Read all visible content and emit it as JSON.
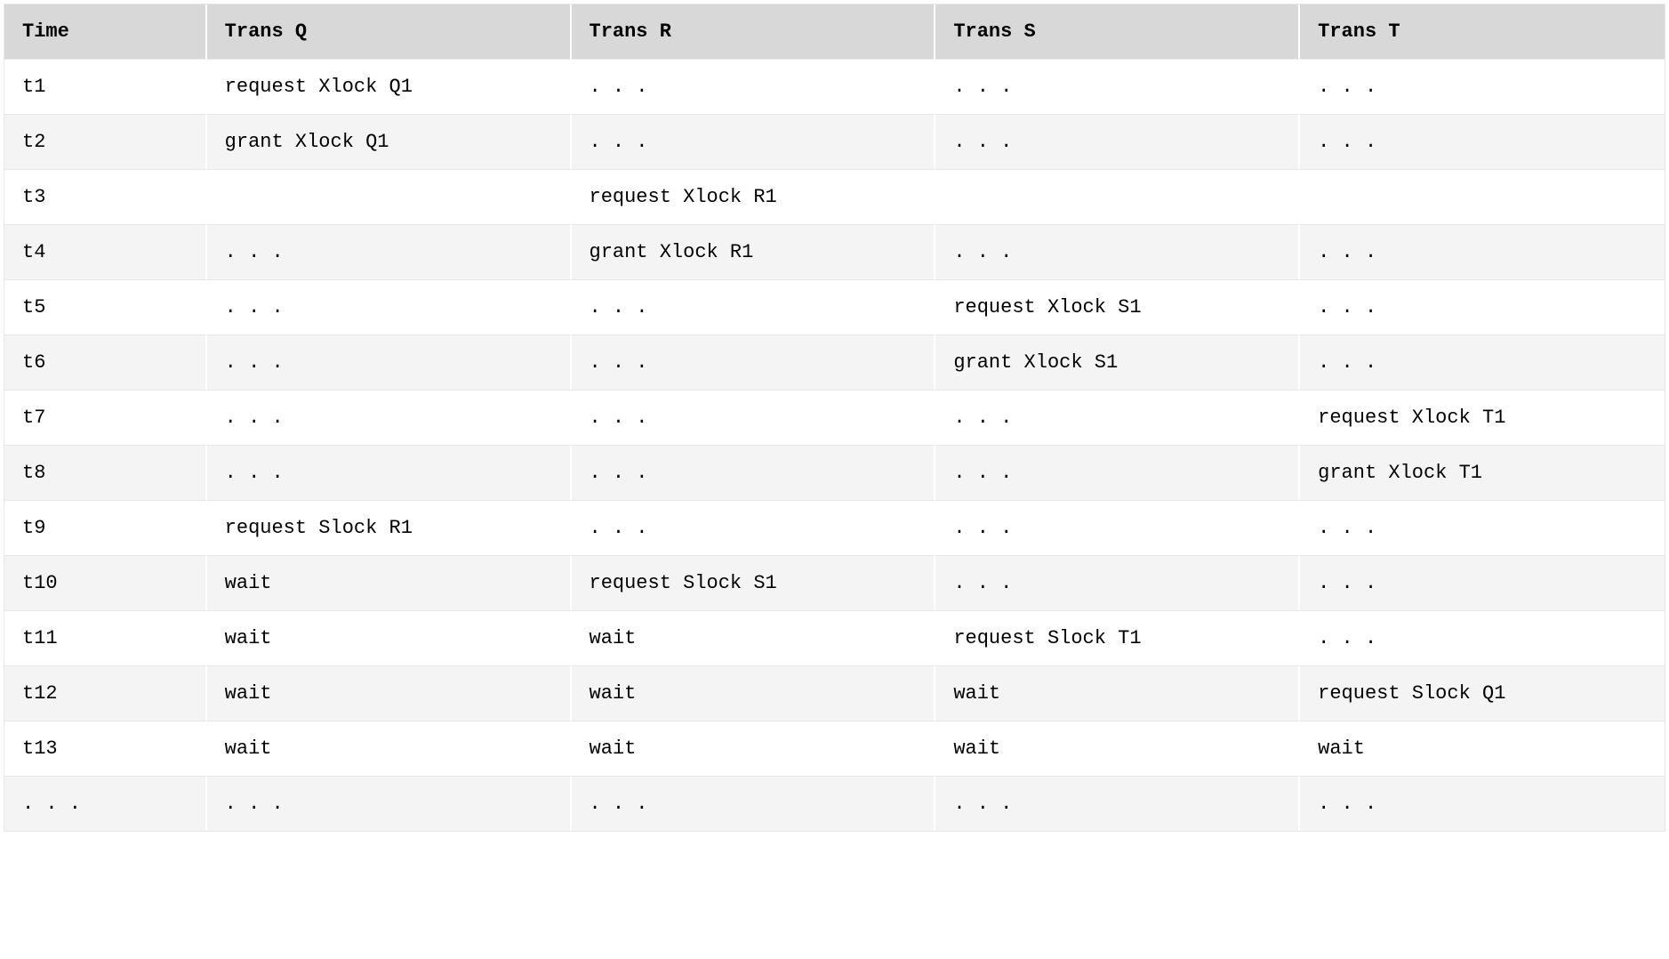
{
  "chart_data": {
    "type": "table",
    "columns": [
      "Time",
      "Trans Q",
      "Trans R",
      "Trans S",
      "Trans T"
    ],
    "rows": [
      [
        "t1",
        "request Xlock Q1",
        ". . .",
        ". . .",
        ". . ."
      ],
      [
        "t2",
        "grant Xlock Q1",
        ". . .",
        ". . .",
        ". . ."
      ],
      [
        "t3",
        "",
        "request Xlock R1",
        "",
        ""
      ],
      [
        "t4",
        ". . .",
        "grant Xlock R1",
        ". . .",
        ". . ."
      ],
      [
        "t5",
        ". . .",
        ". . .",
        "request Xlock S1",
        ". . ."
      ],
      [
        "t6",
        ". . .",
        ". . .",
        "grant Xlock S1",
        ". . ."
      ],
      [
        "t7",
        ". . .",
        ". . .",
        ". . .",
        "request Xlock T1"
      ],
      [
        "t8",
        ". . .",
        ". . .",
        ". . .",
        "grant Xlock T1"
      ],
      [
        "t9",
        "request Slock R1",
        ". . .",
        ". . .",
        ". . ."
      ],
      [
        "t10",
        "wait",
        "request Slock S1",
        ". . .",
        ". . ."
      ],
      [
        "t11",
        "wait",
        "wait",
        "request Slock T1",
        ". . ."
      ],
      [
        "t12",
        "wait",
        "wait",
        "wait",
        "request Slock Q1"
      ],
      [
        "t13",
        "wait",
        "wait",
        "wait",
        "wait"
      ],
      [
        ". . .",
        ". . .",
        ". . .",
        ". . .",
        ". . ."
      ]
    ]
  }
}
